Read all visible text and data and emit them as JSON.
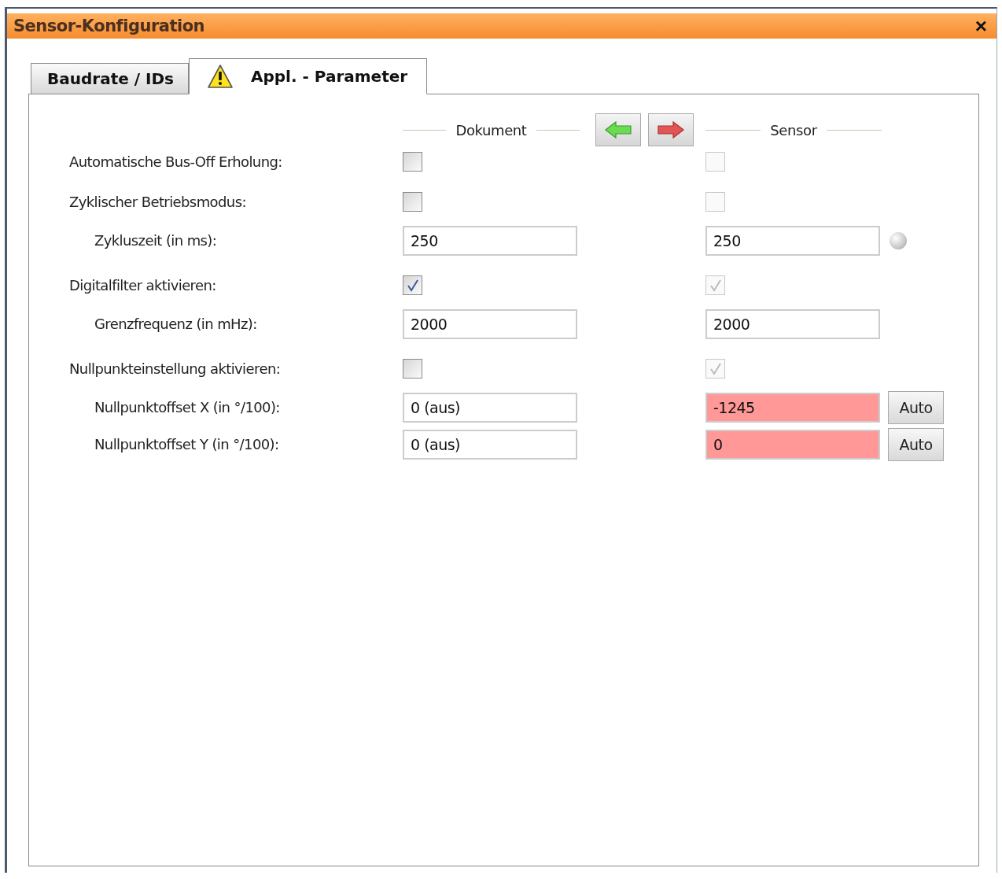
{
  "window": {
    "title": "Sensor-Konfiguration",
    "close": "×"
  },
  "tabs": [
    {
      "label": "Baudrate / IDs",
      "selected": false,
      "warning": false
    },
    {
      "label": "Appl. - Parameter",
      "selected": true,
      "warning": true
    }
  ],
  "columns": {
    "document": "Dokument",
    "sensor": "Sensor"
  },
  "rows": [
    {
      "kind": "checkbox",
      "label": "Automatische Bus-Off Erholung:",
      "document": {
        "checked": false
      },
      "sensor": {
        "checked": false,
        "disabled": true
      }
    },
    {
      "kind": "checkbox",
      "label": "Zyklischer Betriebsmodus:",
      "document": {
        "checked": false
      },
      "sensor": {
        "checked": false,
        "disabled": true
      },
      "children": [
        {
          "kind": "field",
          "label": "Zykluszeit (in ms):",
          "document": {
            "value": "250"
          },
          "sensor": {
            "value": "250",
            "mismatch": false
          },
          "status_led": true
        }
      ]
    },
    {
      "kind": "checkbox",
      "label": "Digitalfilter aktivieren:",
      "document": {
        "checked": true
      },
      "sensor": {
        "checked": true,
        "disabled": true
      },
      "children": [
        {
          "kind": "field",
          "label": "Grenzfrequenz (in mHz):",
          "document": {
            "value": "2000"
          },
          "sensor": {
            "value": "2000",
            "mismatch": false
          }
        }
      ]
    },
    {
      "kind": "checkbox",
      "label": "Nullpunkteinstellung aktivieren:",
      "document": {
        "checked": false
      },
      "sensor": {
        "checked": true,
        "disabled": true
      },
      "children": [
        {
          "kind": "field",
          "label": "Nullpunktoffset X (in °/100):",
          "document": {
            "value": "0 (aus)"
          },
          "sensor": {
            "value": "-1245",
            "mismatch": true
          },
          "button": "Auto"
        },
        {
          "kind": "field",
          "label": "Nullpunktoffset Y (in °/100):",
          "document": {
            "value": "0 (aus)"
          },
          "sensor": {
            "value": "0",
            "mismatch": true
          },
          "button": "Auto"
        }
      ]
    }
  ]
}
